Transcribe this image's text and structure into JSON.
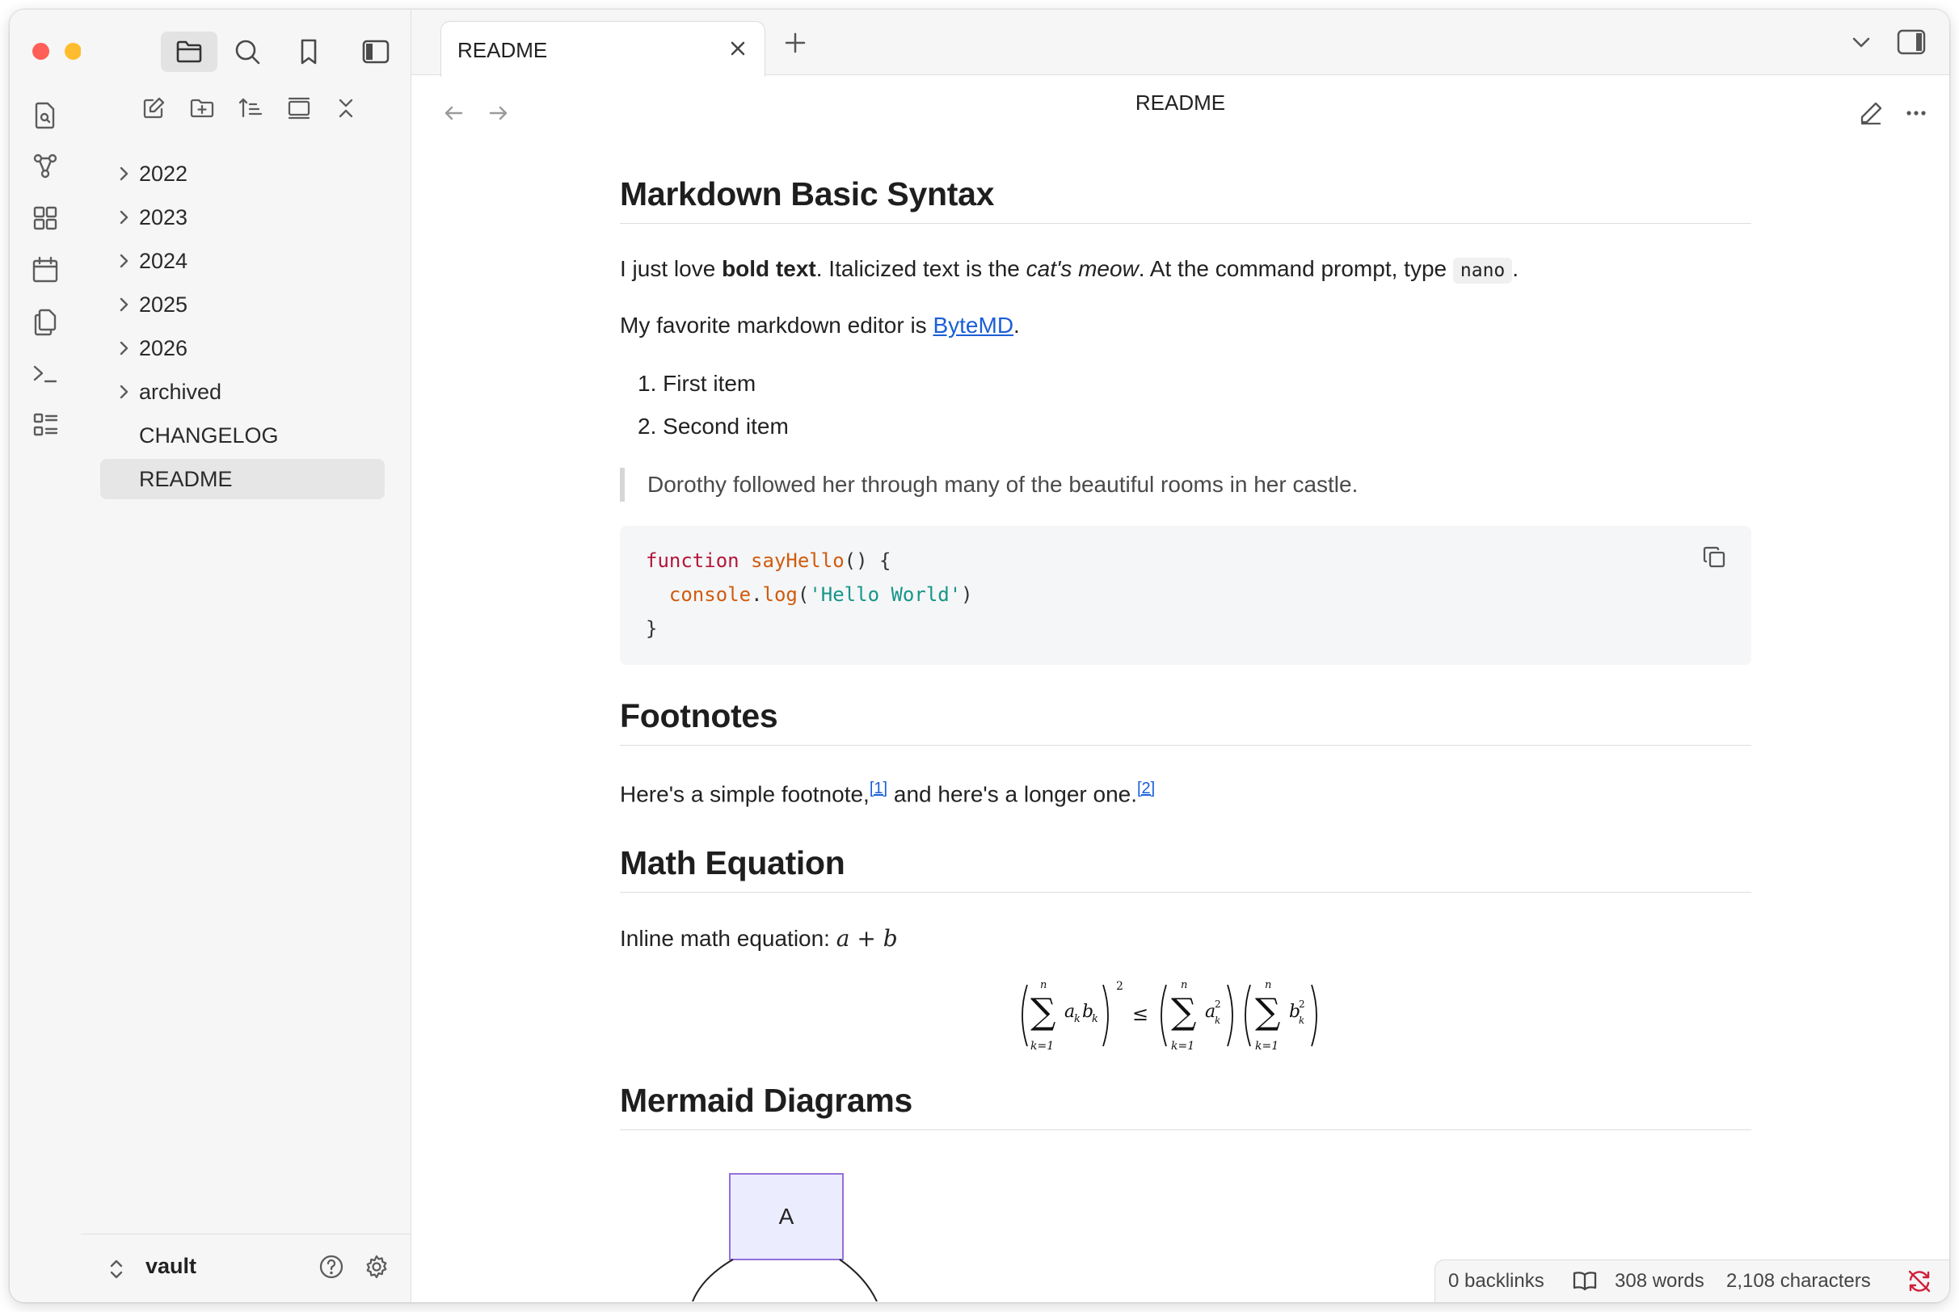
{
  "window": {
    "traffic_colors": {
      "close": "#ff5f57",
      "minimize": "#febc2e",
      "maximize": "#28c840"
    }
  },
  "ribbon": {
    "icons": [
      "quick-switcher-icon",
      "graph-view-icon",
      "canvas-icon",
      "daily-note-icon",
      "templates-icon",
      "command-palette-icon",
      "outline-icon"
    ]
  },
  "sidebar": {
    "top_icons": [
      "files-icon",
      "search-icon",
      "bookmark-icon",
      "sidebar-toggle-icon"
    ],
    "file_tools": [
      "new-note-icon",
      "new-folder-icon",
      "sort-icon",
      "collapse-icon",
      "close-all-icon"
    ],
    "tree": [
      {
        "label": "2022",
        "folder": true
      },
      {
        "label": "2023",
        "folder": true
      },
      {
        "label": "2024",
        "folder": true
      },
      {
        "label": "2025",
        "folder": true
      },
      {
        "label": "2026",
        "folder": true
      },
      {
        "label": "archived",
        "folder": true
      },
      {
        "label": "CHANGELOG",
        "folder": false
      },
      {
        "label": "README",
        "folder": false,
        "selected": true
      }
    ],
    "vault_name": "vault"
  },
  "tab": {
    "title": "README"
  },
  "view": {
    "title": "README"
  },
  "doc": {
    "h_syntax": "Markdown Basic Syntax",
    "p1_a": "I just love ",
    "p1_bold": "bold text",
    "p1_b": ". Italicized text is the ",
    "p1_italic": "cat's meow",
    "p1_c": ". At the command prompt, type ",
    "p1_code": "nano",
    "p1_d": ".",
    "p2_a": "My favorite markdown editor is ",
    "p2_link": "ByteMD",
    "p2_b": ".",
    "list": [
      "First item",
      "Second item"
    ],
    "quote": "Dorothy followed her through many of the beautiful rooms in her castle.",
    "code": {
      "keyword": "function",
      "fname": "sayHello",
      "parens": "() {",
      "obj": "console",
      "dot": ".",
      "method": "log",
      "open": "(",
      "str": "'Hello World'",
      "close": ")",
      "end": "}"
    },
    "h_footnotes": "Footnotes",
    "fn_a": "Here's a simple footnote,",
    "fn_ref1": "[1]",
    "fn_b": " and here's a longer one.",
    "fn_ref2": "[2]",
    "h_math": "Math Equation",
    "math_label": "Inline math equation: ",
    "math_inline": "a + b",
    "h_mermaid": "Mermaid Diagrams",
    "mermaid_node": "A"
  },
  "status": {
    "backlinks": "0 backlinks",
    "words": "308 words",
    "chars": "2,108 characters"
  },
  "colors": {
    "accent": "#1a5fd6",
    "sync_error": "#d0203a",
    "mermaid_fill": "#ececff",
    "mermaid_stroke": "#9370db"
  }
}
